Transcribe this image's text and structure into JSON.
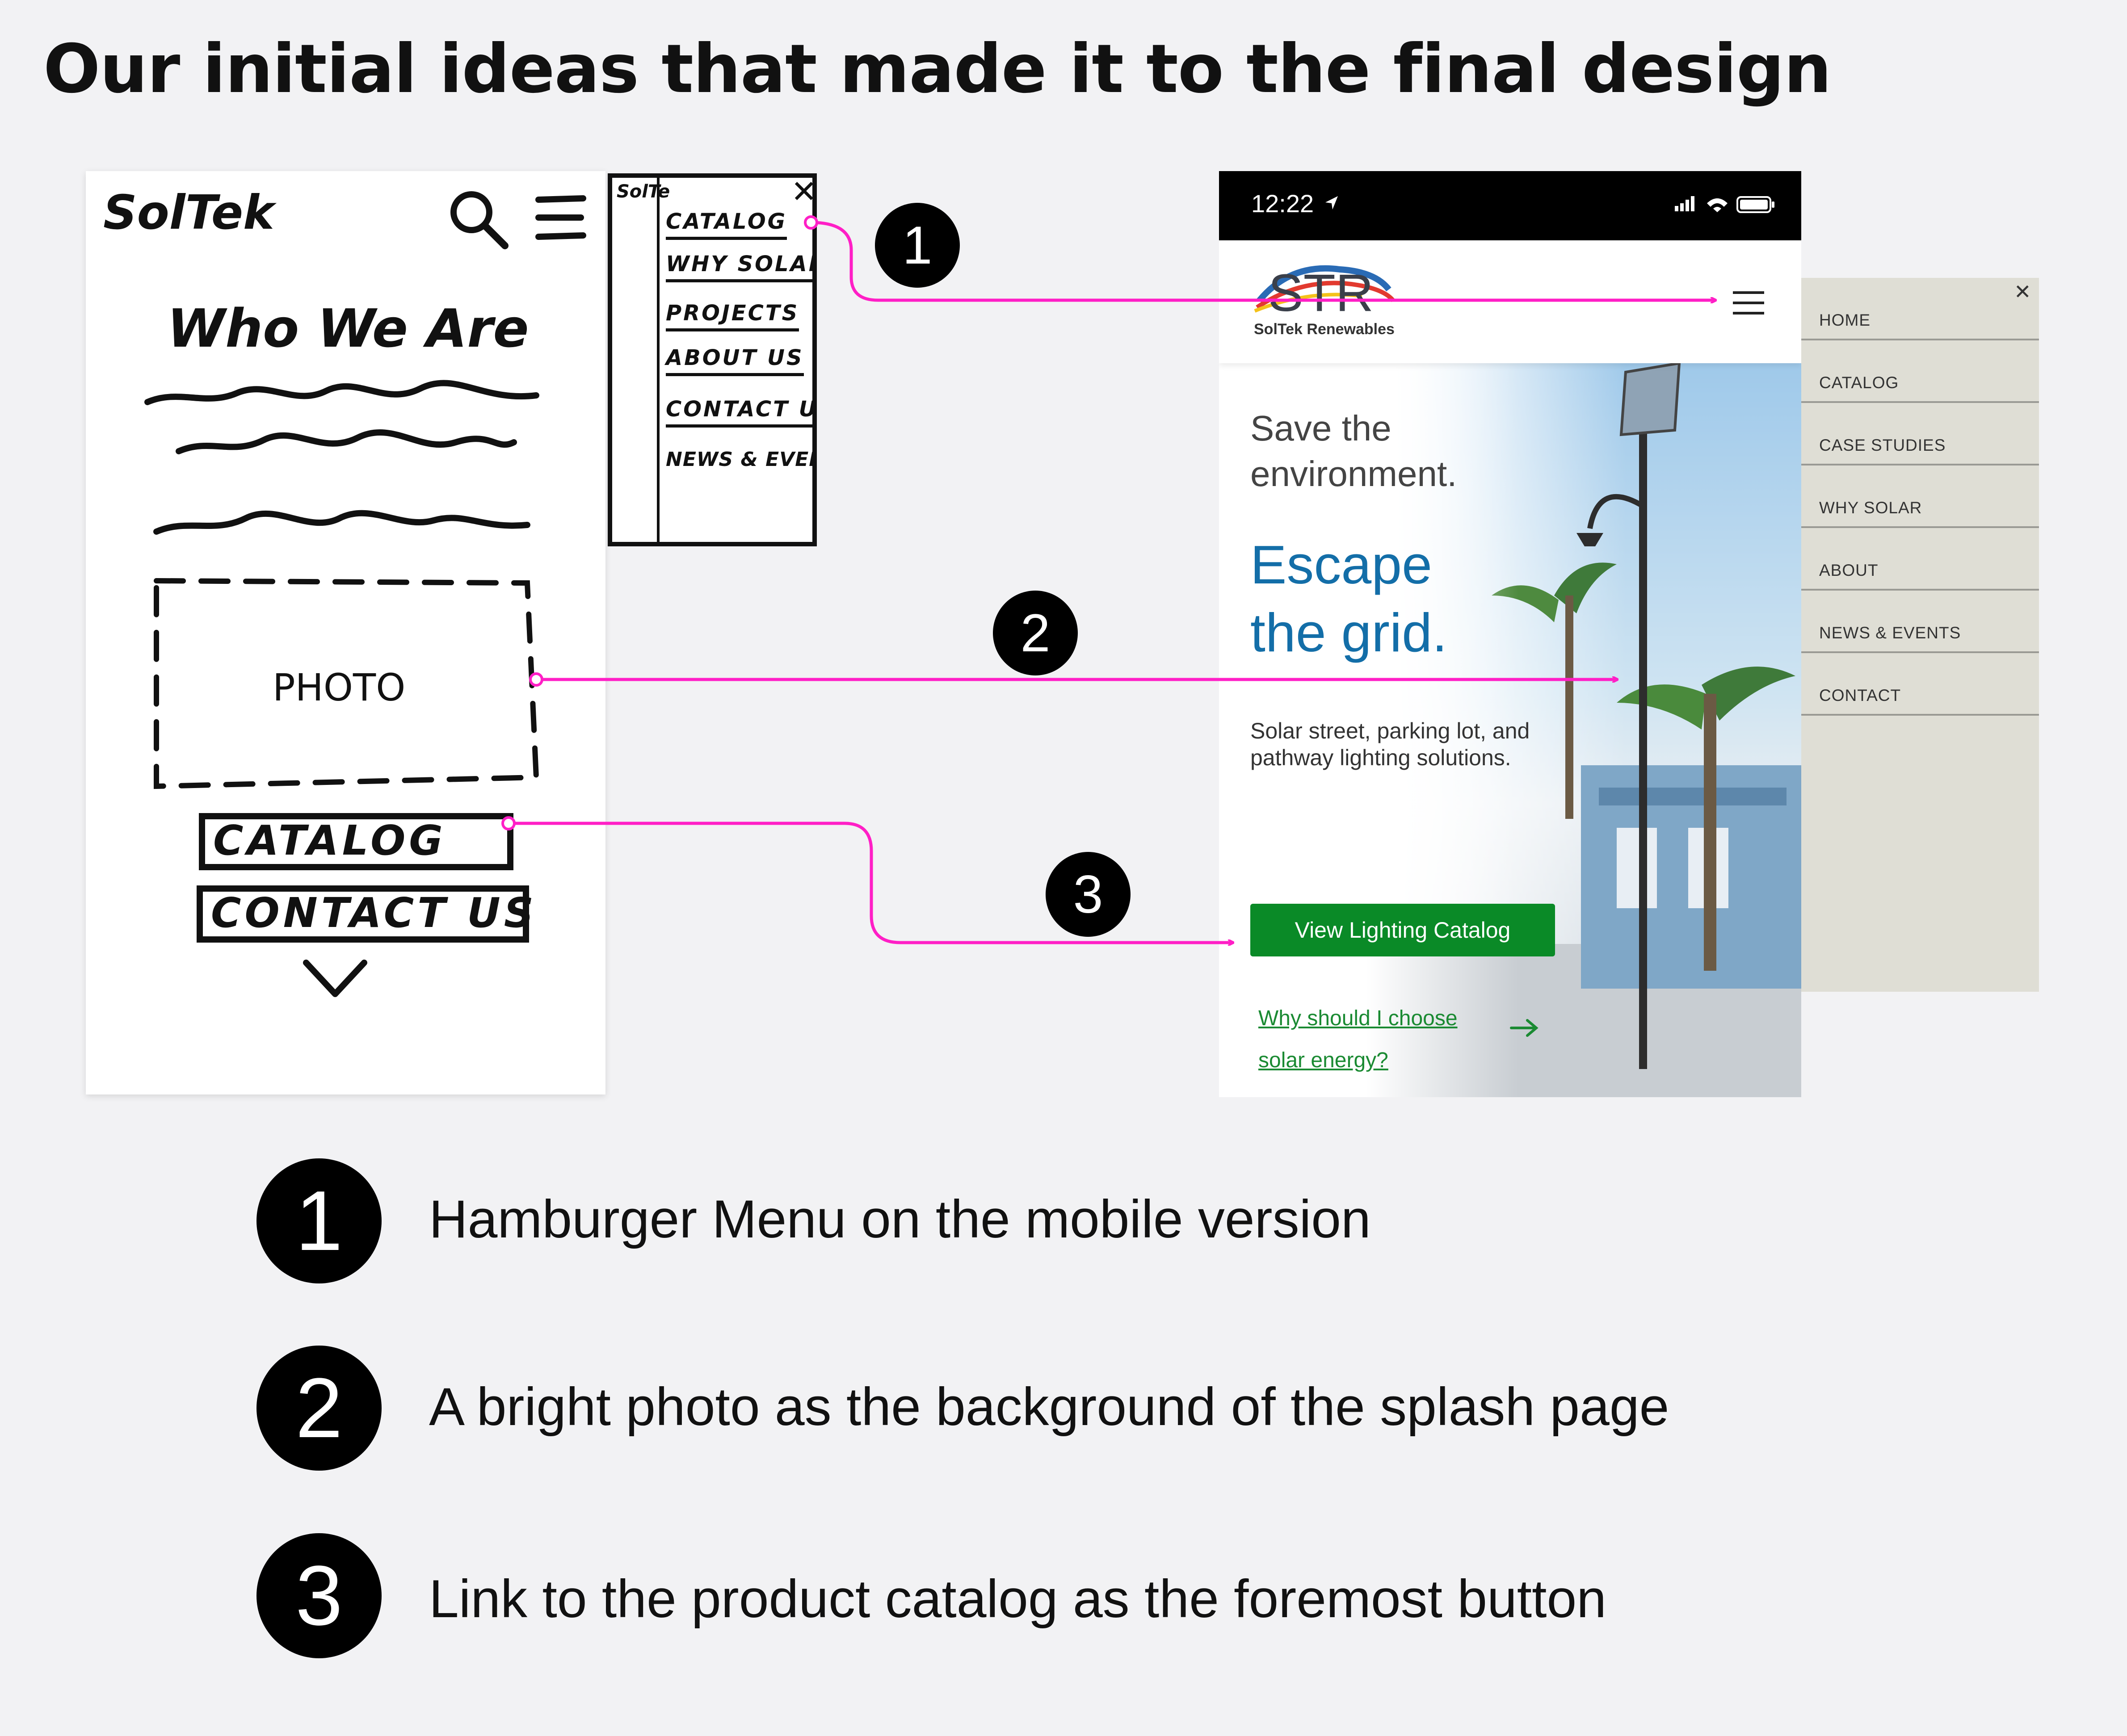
{
  "title": "Our initial ideas that made it to the final design",
  "sketch": {
    "logo": "SolTek",
    "heading": "Who We Are",
    "photo_label": "PHOTO",
    "catalog_button": "CATALOG",
    "contact_button": "CONTACT US",
    "menu_brand": "SolTe",
    "menu_close": "✕",
    "menu_items": [
      "CATALOG",
      "WHY SOLAR",
      "PROJECTS",
      "ABOUT US",
      "CONTACT US",
      "NEWS & EVENTS"
    ]
  },
  "mobile": {
    "status_time": "12:22",
    "brand_logo_text": "STR",
    "brand_name": "SolTek Renewables",
    "hero_line1": "Save the",
    "hero_line1b": "environment.",
    "hero_line2": "Escape",
    "hero_line2b": "the grid.",
    "hero_desc": "Solar street, parking lot, and pathway lighting solutions.",
    "catalog_button": "View Lighting Catalog",
    "solar_link": "Why should I choose solar energy?",
    "menu_close": "✕",
    "menu_items": [
      "HOME",
      "CATALOG",
      "CASE STUDIES",
      "WHY SOLAR",
      "ABOUT",
      "NEWS & EVENTS",
      "CONTACT"
    ]
  },
  "callouts": [
    "1",
    "2",
    "3"
  ],
  "legend": [
    {
      "number": "1",
      "text": "Hamburger Menu  on the mobile version"
    },
    {
      "number": "2",
      "text": "A bright photo as the background of the splash page"
    },
    {
      "number": "3",
      "text": "Link to the product catalog as the foremost button"
    }
  ],
  "colors": {
    "connector": "#ff1fc6",
    "brand_blue": "#136ea8",
    "button_green": "#0a8a27",
    "menu_bg": "#dfded5"
  }
}
